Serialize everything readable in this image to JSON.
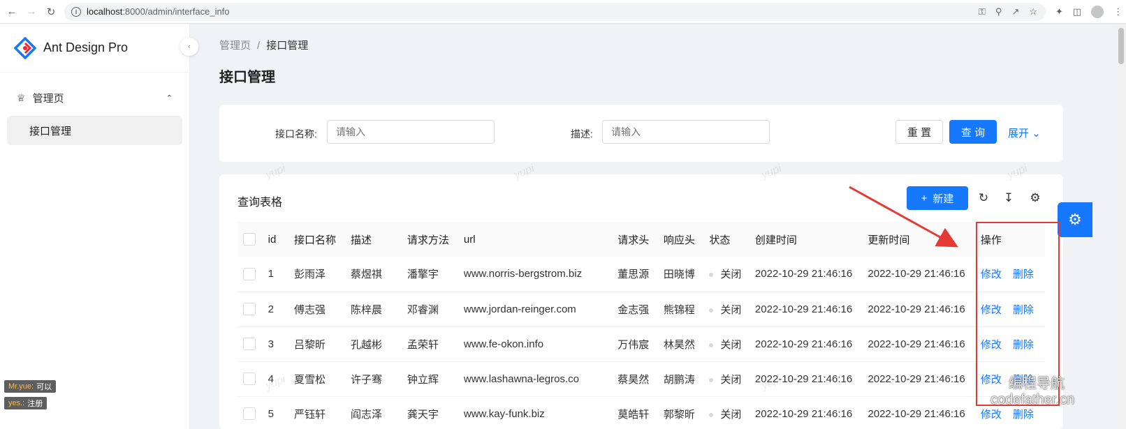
{
  "browser": {
    "url_host": "localhost",
    "url_path": ":8000/admin/interface_info"
  },
  "sidebar": {
    "app_title": "Ant Design Pro",
    "group_label": "管理页",
    "items": [
      {
        "label": "接口管理"
      }
    ]
  },
  "breadcrumb": {
    "root": "管理页",
    "separator": "/",
    "current": "接口管理"
  },
  "page_title": "接口管理",
  "search": {
    "name_label": "接口名称",
    "name_placeholder": "请输入",
    "desc_label": "描述",
    "desc_placeholder": "请输入",
    "reset_label": "重 置",
    "query_label": "查 询",
    "expand_label": "展开"
  },
  "table": {
    "title": "查询表格",
    "new_label": "新建",
    "columns": [
      "id",
      "接口名称",
      "描述",
      "请求方法",
      "url",
      "请求头",
      "响应头",
      "状态",
      "创建时间",
      "更新时间",
      "操作"
    ],
    "rows": [
      {
        "id": "1",
        "name": "彭雨泽",
        "desc": "蔡煜祺",
        "method": "潘擎宇",
        "url": "www.norris-bergstrom.biz",
        "req": "董思源",
        "resp": "田晓博",
        "status": "关闭",
        "created": "2022-10-29 21:46:16",
        "updated": "2022-10-29 21:46:16",
        "edit": "修改",
        "delete": "删除"
      },
      {
        "id": "2",
        "name": "傅志强",
        "desc": "陈梓晨",
        "method": "邓睿渊",
        "url": "www.jordan-reinger.com",
        "req": "金志强",
        "resp": "熊锦程",
        "status": "关闭",
        "created": "2022-10-29 21:46:16",
        "updated": "2022-10-29 21:46:16",
        "edit": "修改",
        "delete": "删除"
      },
      {
        "id": "3",
        "name": "吕黎昕",
        "desc": "孔越彬",
        "method": "孟荣轩",
        "url": "www.fe-okon.info",
        "req": "万伟宸",
        "resp": "林昊然",
        "status": "关闭",
        "created": "2022-10-29 21:46:16",
        "updated": "2022-10-29 21:46:16",
        "edit": "修改",
        "delete": "删除"
      },
      {
        "id": "4",
        "name": "夏雪松",
        "desc": "许子骞",
        "method": "钟立辉",
        "url": "www.lashawna-legros.co",
        "req": "蔡昊然",
        "resp": "胡鹏涛",
        "status": "关闭",
        "created": "2022-10-29 21:46:16",
        "updated": "2022-10-29 21:46:16",
        "edit": "修改",
        "delete": "删除"
      },
      {
        "id": "5",
        "name": "严钰轩",
        "desc": "阎志泽",
        "method": "龚天宇",
        "url": "www.kay-funk.biz",
        "req": "莫皓轩",
        "resp": "郭黎昕",
        "status": "关闭",
        "created": "2022-10-29 21:46:16",
        "updated": "2022-10-29 21:46:16",
        "edit": "修改",
        "delete": "删除"
      }
    ]
  },
  "watermark_text": "yupi",
  "overlay": {
    "tag1_name": "Mr.yue:",
    "tag1_text": "可以",
    "tag2_name": "yes.:",
    "tag2_text": "注册"
  },
  "brand_watermark": {
    "line1": "编程导航",
    "line2": "codefather.cn"
  },
  "colors": {
    "primary": "#1677ff",
    "annotation": "#e53935"
  }
}
